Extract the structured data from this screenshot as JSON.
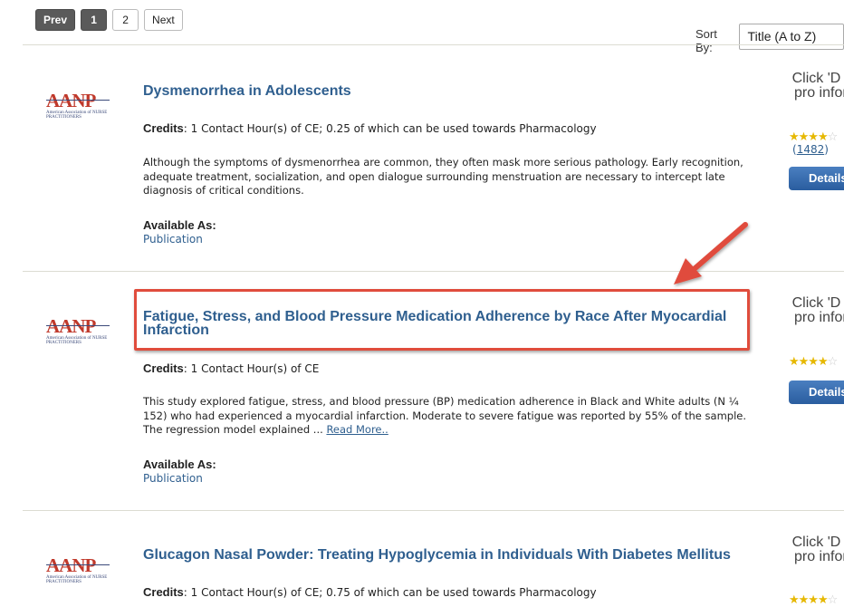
{
  "pagination": {
    "prev": "Prev",
    "pages": [
      "1",
      "2"
    ],
    "next": "Next"
  },
  "sort": {
    "label": "Sort By:",
    "selected": "Title (A to Z)"
  },
  "logo": {
    "main": "AANP",
    "sub": "American Association of NURSE PRACTITIONERS"
  },
  "items": [
    {
      "title": "Dysmenorrhea in Adolescents",
      "credits_label": "Credits",
      "credits": "1 Contact Hour(s) of CE; 0.25 of which can be used towards Pharmacology",
      "description": "Although the symptoms of dysmenorrhea are common, they often mask more serious pathology. Early recognition, adequate treatment, socialization, and open dialogue surrounding menstruation are necessary to intercept late diagnosis of critical conditions.",
      "available_label": "Available As:",
      "available": "Publication",
      "click_text": "Click 'D for pro inform",
      "rating": 4,
      "reviews": "1482",
      "details": "Details"
    },
    {
      "title": "Fatigue, Stress, and Blood Pressure Medication Adherence by Race After Myocardial Infarction",
      "credits_label": "Credits",
      "credits": "1 Contact Hour(s) of CE",
      "description": "This study explored fatigue, stress, and blood pressure (BP) medication adherence in Black and White adults (N ¼ 152) who had experienced a myocardial infarction. Moderate to severe fatigue was reported by 55% of the sample. The regression model explained ...",
      "read_more": "Read More..",
      "available_label": "Available As:",
      "available": "Publication",
      "click_text": "Click 'D for pro inform",
      "rating": 4,
      "details": "Details"
    },
    {
      "title": "Glucagon Nasal Powder: Treating Hypoglycemia in Individuals With Diabetes Mellitus",
      "credits_label": "Credits",
      "credits": "1 Contact Hour(s) of CE; 0.75 of which can be used towards Pharmacology",
      "click_text": "Click 'D for pro inform",
      "rating": 4
    }
  ],
  "colors": {
    "link": "#2f5f8f",
    "annotation": "#e04c3c",
    "details_button": "#2a5d9f",
    "star": "#e6b800"
  }
}
